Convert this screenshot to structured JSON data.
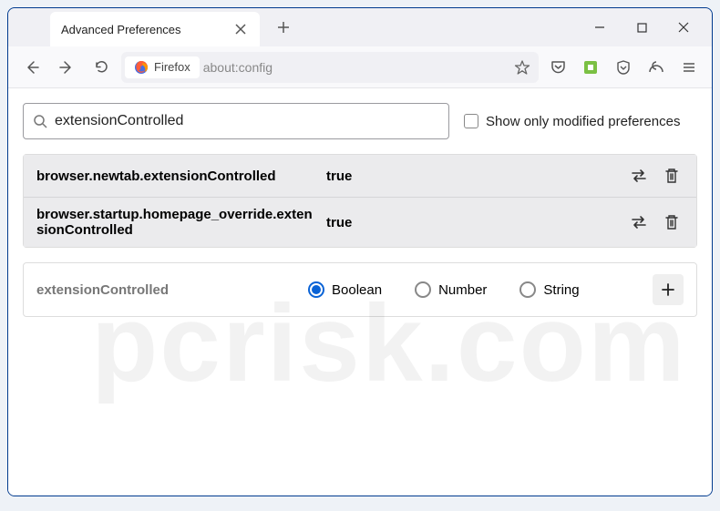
{
  "tab": {
    "title": "Advanced Preferences"
  },
  "urlbar": {
    "identity": "Firefox",
    "url": "about:config"
  },
  "search": {
    "value": "extensionControlled"
  },
  "checkbox": {
    "label": "Show only modified preferences"
  },
  "prefs": [
    {
      "name": "browser.newtab.extensionControlled",
      "value": "true"
    },
    {
      "name": "browser.startup.homepage_override.extensionControlled",
      "value": "true"
    }
  ],
  "newpref": {
    "name": "extensionControlled",
    "types": [
      "Boolean",
      "Number",
      "String"
    ],
    "selected": 0
  },
  "watermark": "pcrisk.com"
}
